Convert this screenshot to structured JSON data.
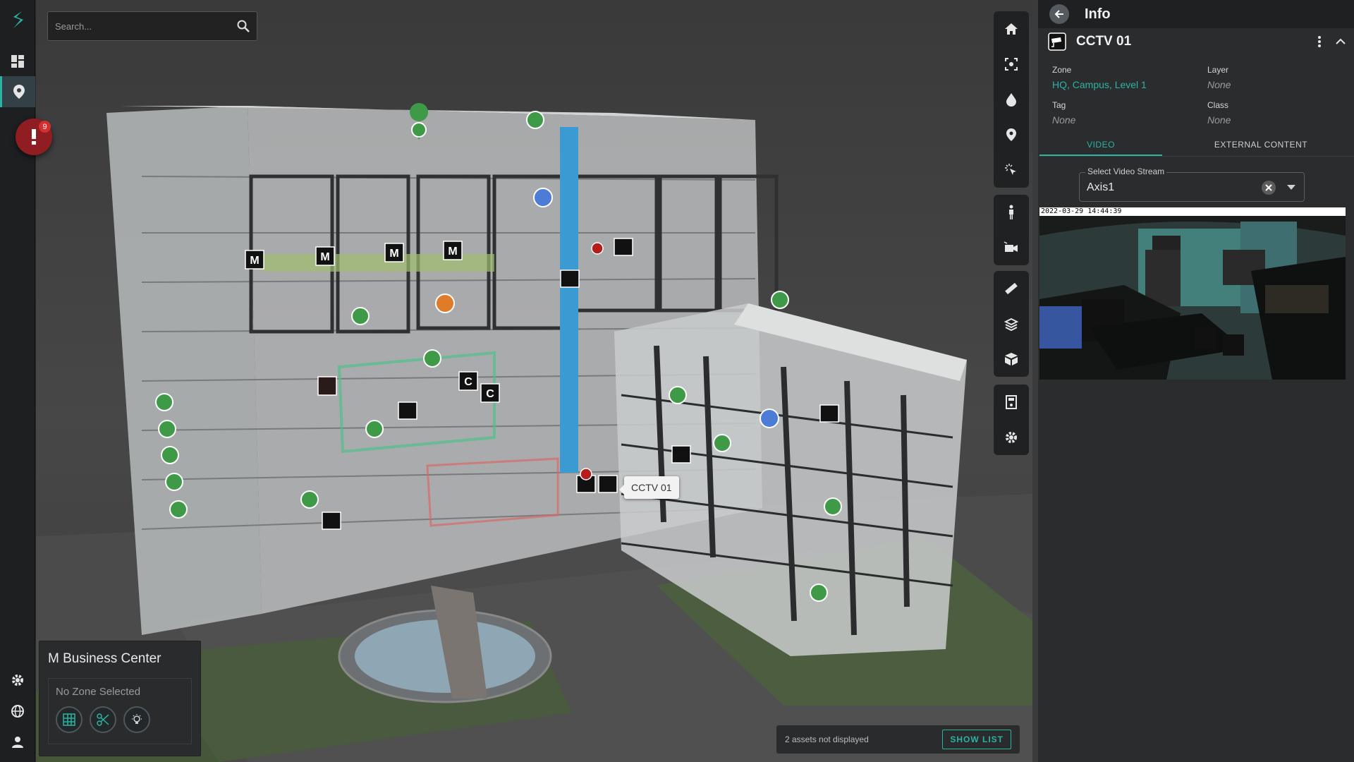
{
  "search": {
    "placeholder": "Search..."
  },
  "alerts": {
    "count": "9"
  },
  "tooltip": {
    "text": "CCTV 01"
  },
  "site": {
    "name": "M Business Center",
    "zone_status": "No Zone Selected"
  },
  "assets_bar": {
    "text": "2 assets not displayed",
    "button": "SHOW LIST"
  },
  "info_panel": {
    "title": "Info",
    "asset_name": "CCTV 01",
    "zone_label": "Zone",
    "zone_links": "HQ, Campus, Level 1",
    "layer_label": "Layer",
    "layer_value": "None",
    "tag_label": "Tag",
    "tag_value": "None",
    "class_label": "Class",
    "class_value": "None",
    "tabs": [
      "VIDEO",
      "EXTERNAL CONTENT"
    ],
    "stream_label": "Select Video Stream",
    "stream_value": "Axis1",
    "video_timestamp": "2022-03-29 14:44:39"
  },
  "markers": {
    "M": "M",
    "C": "C"
  },
  "colors": {
    "accent": "#2bb3a3",
    "marker_green": "#3f9a48",
    "marker_blue": "#4d7cd6",
    "marker_orange": "#e07b2a",
    "alert_red": "#b71c1c"
  }
}
